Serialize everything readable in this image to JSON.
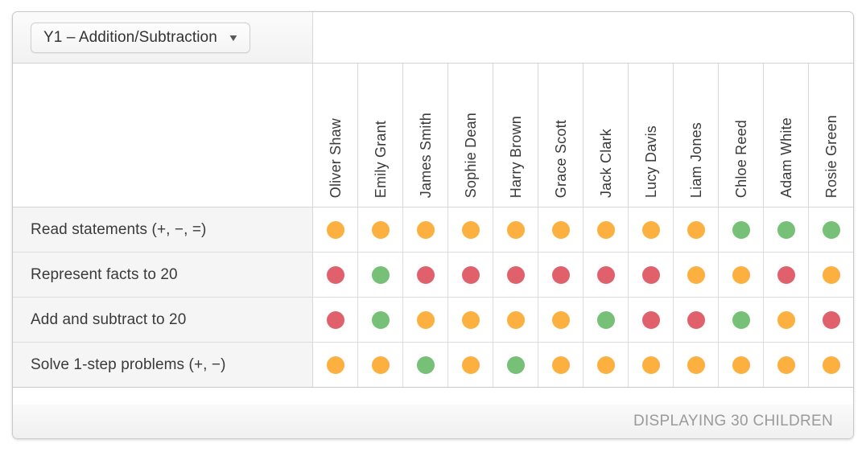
{
  "toolbar": {
    "topic_selector": {
      "label": "Y1 – Addition/Subtraction",
      "caret": "▼"
    }
  },
  "grid": {
    "children": [
      "Oliver Shaw",
      "Emily Grant",
      "James Smith",
      "Sophie Dean",
      "Harry Brown",
      "Grace Scott",
      "Jack Clark",
      "Lucy Davis",
      "Liam Jones",
      "Chloe Reed",
      "Adam White",
      "Rosie Green"
    ],
    "objectives": [
      "Read statements (+, −, =)",
      "Represent facts to 20",
      "Add and subtract to 20",
      "Solve 1-step problems (+, −)"
    ],
    "statuses": [
      [
        "amber",
        "amber",
        "amber",
        "amber",
        "amber",
        "amber",
        "amber",
        "amber",
        "amber",
        "green",
        "green",
        "green"
      ],
      [
        "red",
        "green",
        "red",
        "red",
        "red",
        "red",
        "red",
        "red",
        "amber",
        "amber",
        "red",
        "amber"
      ],
      [
        "red",
        "green",
        "amber",
        "amber",
        "amber",
        "amber",
        "green",
        "red",
        "red",
        "green",
        "amber",
        "red"
      ],
      [
        "amber",
        "amber",
        "green",
        "amber",
        "green",
        "amber",
        "amber",
        "amber",
        "amber",
        "amber",
        "amber",
        "amber"
      ]
    ],
    "status_colors": {
      "red": "#e0616b",
      "amber": "#fbb040",
      "green": "#76c077"
    }
  },
  "footer": {
    "count_text": "DISPLAYING 30 CHILDREN"
  }
}
